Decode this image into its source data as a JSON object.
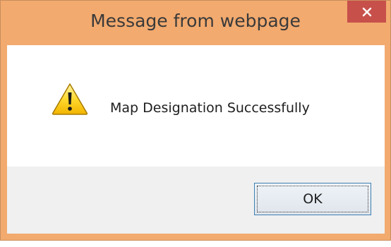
{
  "dialog": {
    "title": "Message from webpage",
    "close_icon": "close-icon",
    "message": "Message from webpage",
    "icon": "warning-icon",
    "body_text": "Map Designation Successfully",
    "ok_label": "OK",
    "colors": {
      "frame": "#f2aa6f",
      "close_button": "#c7504b",
      "content_bg": "#ffffff",
      "footer_bg": "#f0f0f0",
      "button_border": "#3c7fb1"
    }
  }
}
